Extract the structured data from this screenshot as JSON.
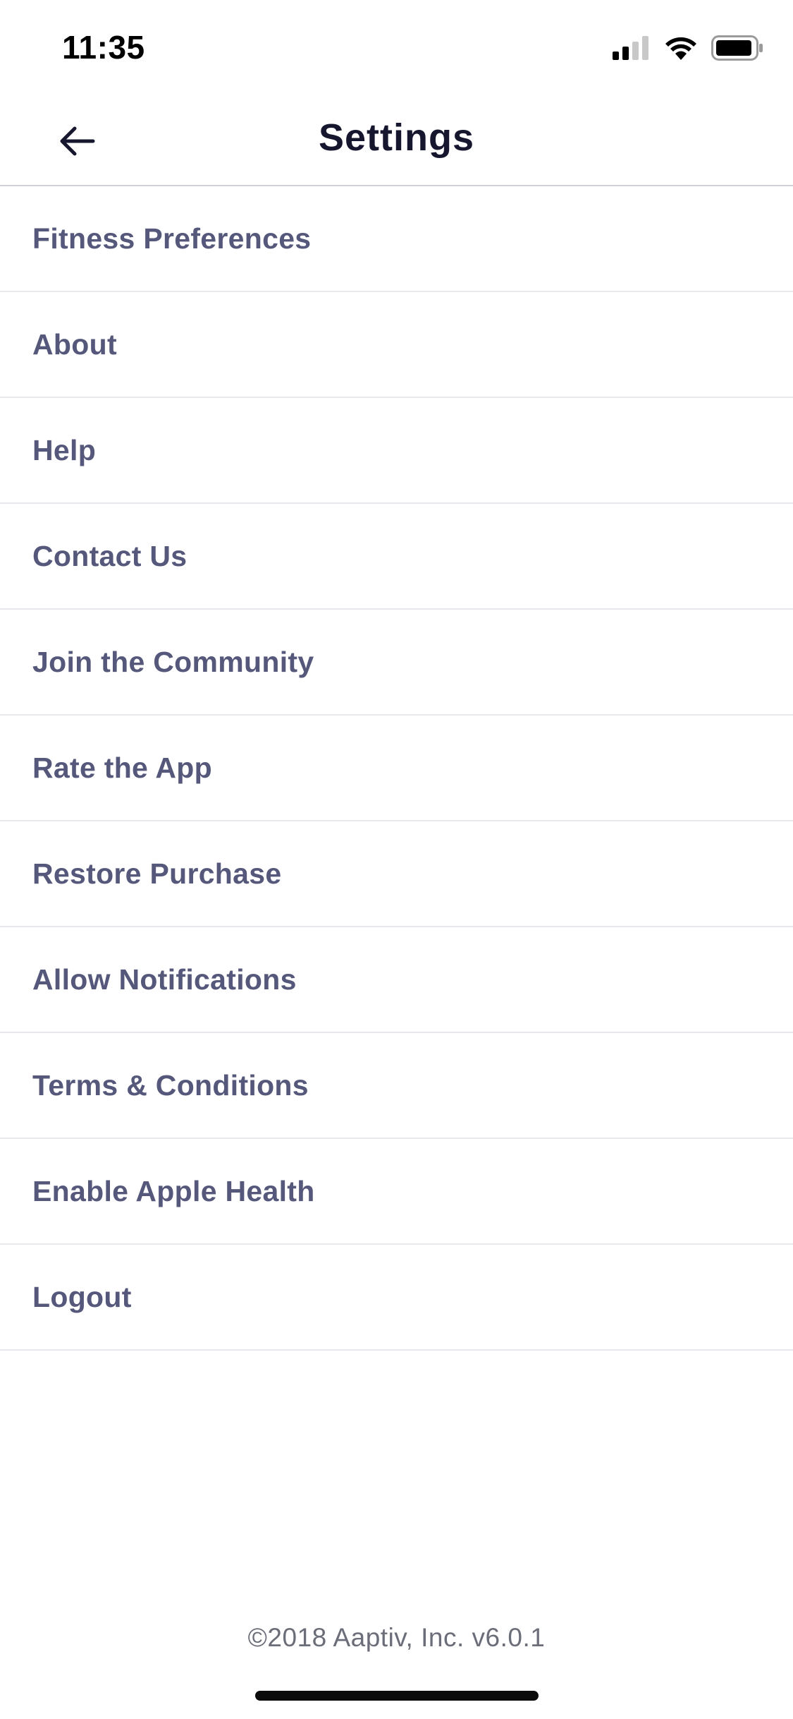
{
  "status_bar": {
    "time": "11:35"
  },
  "header": {
    "title": "Settings",
    "back_icon": "arrow-left-icon"
  },
  "settings": {
    "items": [
      {
        "label": "Fitness Preferences"
      },
      {
        "label": "About"
      },
      {
        "label": "Help"
      },
      {
        "label": "Contact Us"
      },
      {
        "label": "Join the Community"
      },
      {
        "label": "Rate the App"
      },
      {
        "label": "Restore Purchase"
      },
      {
        "label": "Allow Notifications"
      },
      {
        "label": "Terms & Conditions"
      },
      {
        "label": "Enable Apple Health"
      },
      {
        "label": "Logout"
      }
    ]
  },
  "footer": {
    "text": "©2018 Aaptiv, Inc. v6.0.1"
  },
  "colors": {
    "title": "#16172e",
    "item_text": "#55587a",
    "divider": "#e7e8ec",
    "footer_text": "#6b6d78"
  }
}
